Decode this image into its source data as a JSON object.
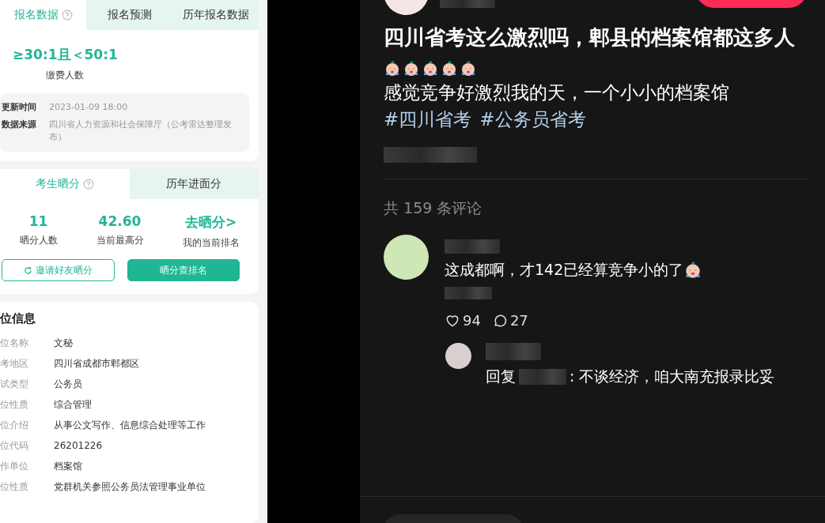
{
  "image": {
    "registration": {
      "tabs": [
        {
          "label": "报名数据",
          "selected": true,
          "help": true
        },
        {
          "label": "报名预测",
          "selected": false,
          "help": false
        },
        {
          "label": "历年报名数据",
          "selected": false,
          "help": false
        }
      ],
      "stat_value": "≥30:1且＜50:1",
      "stat_label": "缴费人数",
      "info": [
        {
          "label": "更新时间",
          "value": "2023-01-09 18:00"
        },
        {
          "label": "数据来源",
          "value": "四川省人力资源和社会保障厅（公考雷达整理发布）"
        }
      ]
    },
    "scores": {
      "tabs": [
        {
          "label": "考生晒分",
          "selected": true,
          "help": true
        },
        {
          "label": "历年进面分",
          "selected": false,
          "help": false
        }
      ],
      "stats": [
        {
          "value": "11",
          "label": "晒分人数"
        },
        {
          "value": "42.60",
          "label": "当前最高分"
        },
        {
          "value": "去晒分>",
          "label": "我的当前排名"
        }
      ],
      "buttons": [
        {
          "label": "邀请好友晒分",
          "kind": "outline"
        },
        {
          "label": "晒分查排名",
          "kind": "filled"
        }
      ]
    },
    "position": {
      "title": "位信息",
      "rows": [
        {
          "label": "位名称",
          "value": "文秘"
        },
        {
          "label": "考地区",
          "value": "四川省成都市郫都区"
        },
        {
          "label": "试类型",
          "value": "公务员"
        },
        {
          "label": "位性质",
          "value": "综合管理"
        },
        {
          "label": "位介绍",
          "value": "从事公文写作、信息综合处理等工作"
        },
        {
          "label": "位代码",
          "value": "26201226"
        },
        {
          "label": "作单位",
          "value": "档案馆"
        },
        {
          "label": "位性质",
          "value": "党群机关参照公务员法管理事业单位"
        }
      ]
    }
  },
  "post": {
    "title": "四川省考这么激烈吗，郫县的档案馆都这多人",
    "body": "感觉竞争好激烈我的天，一个小小的档案馆",
    "hashtags": [
      "#四川省考",
      "#公务员省考"
    ]
  },
  "comments": {
    "count_text": "共 159 条评论",
    "items": [
      {
        "text": "这成都啊，才142已经算竞争小的了",
        "likes": "94",
        "replies": "27"
      }
    ],
    "reply": {
      "prefix": "回复",
      "text": ": 不谈经济，咱大南充报录比妥"
    }
  }
}
